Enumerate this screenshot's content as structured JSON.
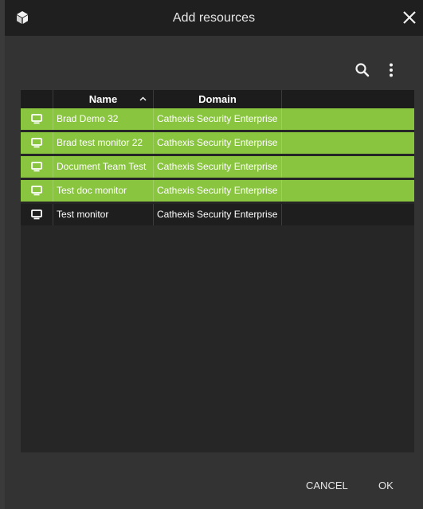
{
  "dialog": {
    "title": "Add resources",
    "app_icon": "cube-icon",
    "close_icon": "close-icon"
  },
  "toolbar": {
    "search_icon": "search-icon",
    "more_icon": "more-vertical-icon"
  },
  "table": {
    "columns": {
      "name": "Name",
      "domain": "Domain"
    },
    "sort": {
      "column": "Name",
      "direction": "ascending"
    },
    "rows": [
      {
        "name": "Brad Demo 32",
        "domain": "Cathexis Security Enterprise",
        "selected": true,
        "icon": "monitor-icon"
      },
      {
        "name": "Brad test monitor 22",
        "domain": "Cathexis Security Enterprise",
        "selected": true,
        "icon": "monitor-icon"
      },
      {
        "name": "Document Team Test",
        "domain": "Cathexis Security Enterprise",
        "selected": true,
        "icon": "monitor-icon"
      },
      {
        "name": "Test doc monitor",
        "domain": "Cathexis Security Enterprise",
        "selected": true,
        "icon": "monitor-icon"
      },
      {
        "name": "Test monitor",
        "domain": "Cathexis Security Enterprise",
        "selected": false,
        "icon": "monitor-icon"
      }
    ]
  },
  "footer": {
    "cancel_label": "CANCEL",
    "ok_label": "OK"
  },
  "colors": {
    "selected_row": "#8ac540",
    "titlebar": "#1f1f1f",
    "dialog_bg": "#333333"
  }
}
